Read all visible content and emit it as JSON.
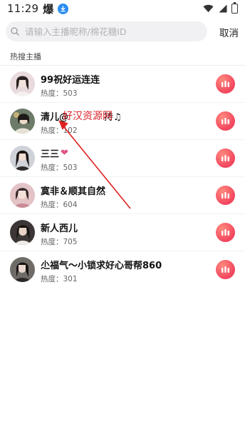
{
  "status_bar": {
    "time": "11:29",
    "extra_glyph": "爆",
    "icons": [
      "download-icon",
      "wifi-icon",
      "signal-icon",
      "battery-icon"
    ]
  },
  "search": {
    "placeholder": "请输入主播昵称/棉花糖ID",
    "value": "",
    "cancel_label": "取消"
  },
  "section": {
    "label": "热搜主播"
  },
  "heat_prefix": "热度：",
  "accent_color": "#f2455e",
  "anchors": [
    {
      "name": "99祝好运连连",
      "suffix": "",
      "heat_label": "热度：",
      "heat": "503",
      "avatar_color": "#e8d3d6"
    },
    {
      "name": "清儿@",
      "suffix": "持♫",
      "heat_label": "热度：",
      "heat": "102",
      "avatar_color": "#5b6b58"
    },
    {
      "name": "三三",
      "suffix": "❤",
      "heat_label": "热度：",
      "heat": "503",
      "avatar_color": "#c7c9cf"
    },
    {
      "name": "寞非＆顺其自然",
      "suffix": "",
      "heat_label": "热度：",
      "heat": "604",
      "avatar_color": "#d9b4b9"
    },
    {
      "name": "新人西儿",
      "suffix": "",
      "heat_label": "热度：",
      "heat": "705",
      "avatar_color": "#3a3535"
    },
    {
      "name": "尐福气～小锁求好心哥帮860",
      "suffix": "",
      "heat_label": "热度：",
      "heat": "301",
      "avatar_color": "#6c6a66"
    }
  ],
  "watermark": {
    "text": "好汉资源网"
  }
}
